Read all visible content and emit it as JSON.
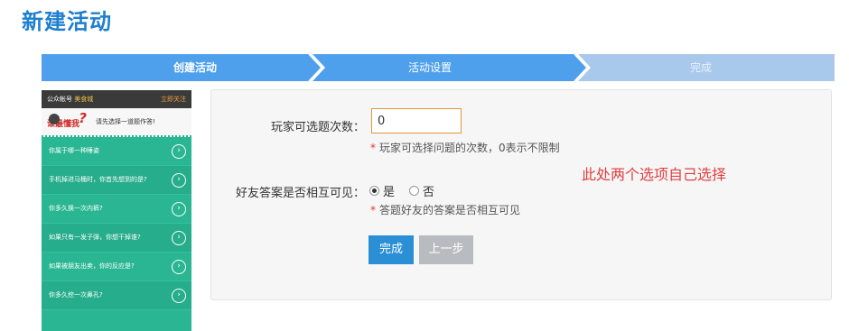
{
  "page": {
    "title": "新建活动"
  },
  "steps": [
    {
      "label": "创建活动",
      "state": "done"
    },
    {
      "label": "活动设置",
      "state": "active"
    },
    {
      "label": "完成",
      "state": "pending"
    }
  ],
  "colors": {
    "accent": "#2b8fd6",
    "step_active": "#4fa0ec",
    "step_pending": "#a9c9ec",
    "phone_bg": "#2ab693",
    "note_red": "#e04040"
  },
  "preview": {
    "account_prefix": "公众帐号",
    "account_name": "美食城",
    "follow_link": "立即关注",
    "logo_text": "谁最懂我",
    "banner_text": "请先选择一道题作答!",
    "questions": [
      "你属于哪一种睡姿",
      "手机掉进马桶时，你首先想到的是?",
      "你多久换一次内裤?",
      "如果只有一发子弹，你想干掉谁?",
      "如果被朋友出卖，你的反应是?",
      "你多久挖一次鼻孔?"
    ]
  },
  "settings": {
    "times_label": "玩家可选题次数：",
    "times_value": "0",
    "times_hint": "玩家可选择问题的次数，0表示不限制",
    "visibility_label": "好友答案是否相互可见：",
    "option_yes": "是",
    "option_no": "否",
    "selected": "是",
    "visibility_hint": "答题好友的答案是否相互可见",
    "note": "此处两个选项自己选择",
    "done_label": "完成",
    "prev_label": "上一步"
  }
}
